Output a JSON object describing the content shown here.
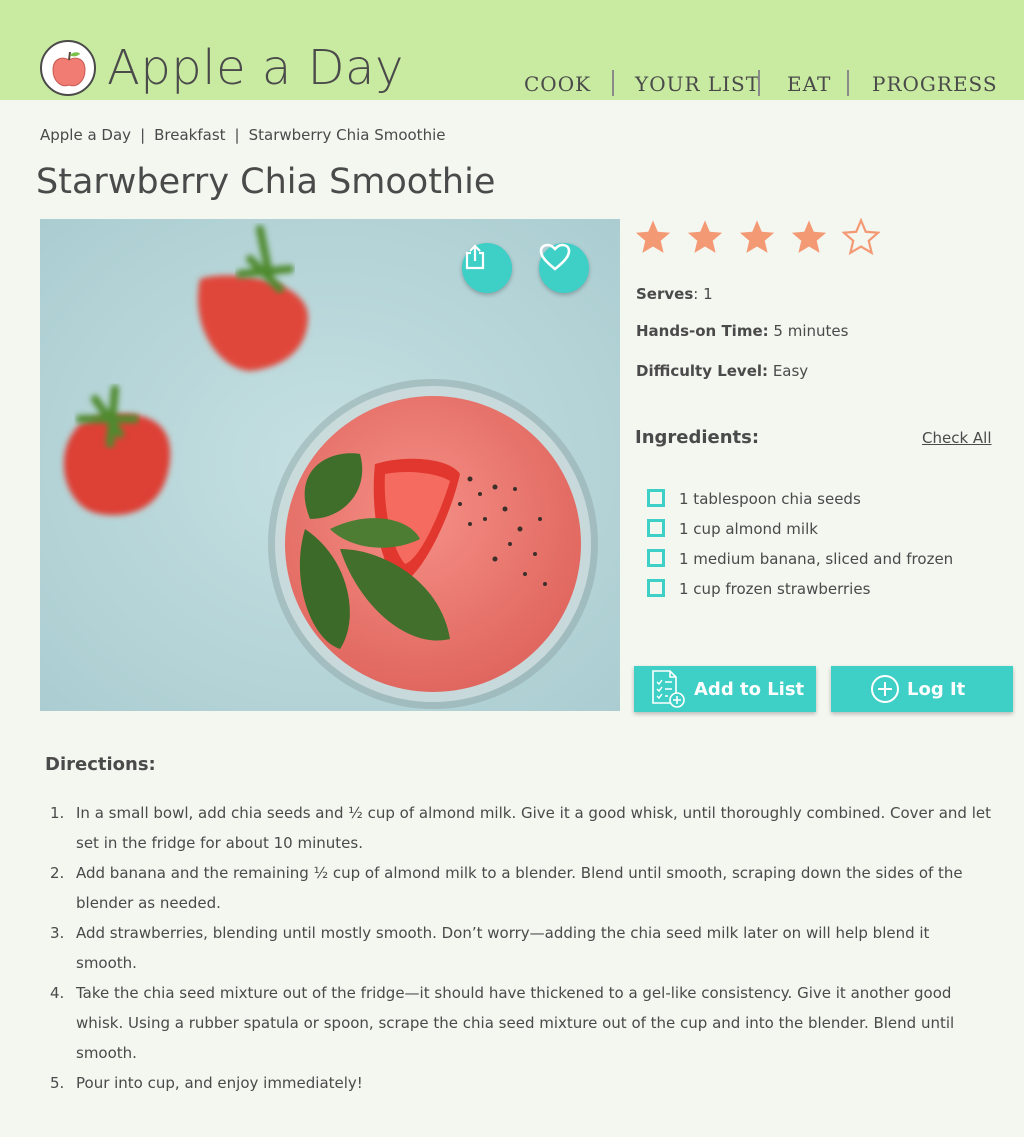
{
  "app": {
    "title": "Apple a Day"
  },
  "nav": {
    "items": [
      "COOK",
      "YOUR LIST",
      "EAT",
      "PROGRESS"
    ]
  },
  "breadcrumb": [
    "Apple a Day",
    "Breakfast",
    "Starwberry Chia Smoothie"
  ],
  "recipe": {
    "title": "Starwberry Chia Smoothie",
    "rating": 4,
    "rating_max": 5,
    "serves_label": "Serves",
    "serves_value": "1",
    "hands_on_label": "Hands-on Time:",
    "hands_on_value": "5 minutes",
    "difficulty_label": "Difficulty Level:",
    "difficulty_value": "Easy"
  },
  "ingredients": {
    "title": "Ingredients:",
    "check_all": "Check All",
    "items": [
      "1 tablespoon chia seeds",
      "1 cup almond milk",
      "1 medium banana, sliced and frozen",
      "1 cup frozen strawberries"
    ]
  },
  "actions": {
    "add_to_list": "Add to List",
    "log_it": "Log It"
  },
  "directions": {
    "title": "Directions:",
    "steps": [
      "In a small bowl, add chia seeds and ½ cup of almond milk. Give it a good whisk, until thoroughly combined. Cover and let set in the fridge for about 10 minutes.",
      "Add banana and the remaining ½ cup of almond milk to a blender. Blend until smooth, scraping down the sides of the blender as needed.",
      "Add strawberries, blending until mostly smooth. Don’t worry—adding the chia seed milk later on will help blend it smooth.",
      "Take the chia seed mixture out of the fridge—it should have thickened to a gel-like consistency. Give it another good whisk. Using a rubber spatula or spoon, scrape the chia seed mixture out of the cup and into the blender. Blend until smooth.",
      "Pour into cup, and enjoy immediately!"
    ]
  },
  "colors": {
    "header_bg": "#c8eaa1",
    "accent": "#3ecfc6",
    "star": "#f39a75",
    "page_bg": "#f4f6f0"
  },
  "icons": {
    "logo": "apple-icon",
    "share": "share-icon",
    "favorite": "heart-icon",
    "add_list": "checklist-add-icon",
    "log": "plus-circle-icon",
    "checkbox": "checkbox-icon",
    "star": "star-icon"
  }
}
